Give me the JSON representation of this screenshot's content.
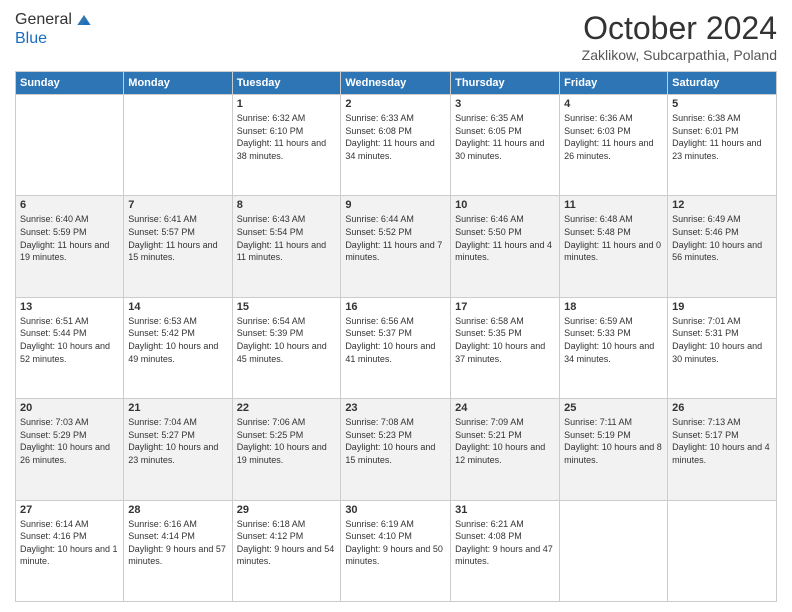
{
  "header": {
    "logo_line1": "General",
    "logo_line2": "Blue",
    "month": "October 2024",
    "location": "Zaklikow, Subcarpathia, Poland"
  },
  "days_of_week": [
    "Sunday",
    "Monday",
    "Tuesday",
    "Wednesday",
    "Thursday",
    "Friday",
    "Saturday"
  ],
  "weeks": [
    [
      {
        "day": "",
        "content": ""
      },
      {
        "day": "",
        "content": ""
      },
      {
        "day": "1",
        "content": "Sunrise: 6:32 AM\nSunset: 6:10 PM\nDaylight: 11 hours and 38 minutes."
      },
      {
        "day": "2",
        "content": "Sunrise: 6:33 AM\nSunset: 6:08 PM\nDaylight: 11 hours and 34 minutes."
      },
      {
        "day": "3",
        "content": "Sunrise: 6:35 AM\nSunset: 6:05 PM\nDaylight: 11 hours and 30 minutes."
      },
      {
        "day": "4",
        "content": "Sunrise: 6:36 AM\nSunset: 6:03 PM\nDaylight: 11 hours and 26 minutes."
      },
      {
        "day": "5",
        "content": "Sunrise: 6:38 AM\nSunset: 6:01 PM\nDaylight: 11 hours and 23 minutes."
      }
    ],
    [
      {
        "day": "6",
        "content": "Sunrise: 6:40 AM\nSunset: 5:59 PM\nDaylight: 11 hours and 19 minutes."
      },
      {
        "day": "7",
        "content": "Sunrise: 6:41 AM\nSunset: 5:57 PM\nDaylight: 11 hours and 15 minutes."
      },
      {
        "day": "8",
        "content": "Sunrise: 6:43 AM\nSunset: 5:54 PM\nDaylight: 11 hours and 11 minutes."
      },
      {
        "day": "9",
        "content": "Sunrise: 6:44 AM\nSunset: 5:52 PM\nDaylight: 11 hours and 7 minutes."
      },
      {
        "day": "10",
        "content": "Sunrise: 6:46 AM\nSunset: 5:50 PM\nDaylight: 11 hours and 4 minutes."
      },
      {
        "day": "11",
        "content": "Sunrise: 6:48 AM\nSunset: 5:48 PM\nDaylight: 11 hours and 0 minutes."
      },
      {
        "day": "12",
        "content": "Sunrise: 6:49 AM\nSunset: 5:46 PM\nDaylight: 10 hours and 56 minutes."
      }
    ],
    [
      {
        "day": "13",
        "content": "Sunrise: 6:51 AM\nSunset: 5:44 PM\nDaylight: 10 hours and 52 minutes."
      },
      {
        "day": "14",
        "content": "Sunrise: 6:53 AM\nSunset: 5:42 PM\nDaylight: 10 hours and 49 minutes."
      },
      {
        "day": "15",
        "content": "Sunrise: 6:54 AM\nSunset: 5:39 PM\nDaylight: 10 hours and 45 minutes."
      },
      {
        "day": "16",
        "content": "Sunrise: 6:56 AM\nSunset: 5:37 PM\nDaylight: 10 hours and 41 minutes."
      },
      {
        "day": "17",
        "content": "Sunrise: 6:58 AM\nSunset: 5:35 PM\nDaylight: 10 hours and 37 minutes."
      },
      {
        "day": "18",
        "content": "Sunrise: 6:59 AM\nSunset: 5:33 PM\nDaylight: 10 hours and 34 minutes."
      },
      {
        "day": "19",
        "content": "Sunrise: 7:01 AM\nSunset: 5:31 PM\nDaylight: 10 hours and 30 minutes."
      }
    ],
    [
      {
        "day": "20",
        "content": "Sunrise: 7:03 AM\nSunset: 5:29 PM\nDaylight: 10 hours and 26 minutes."
      },
      {
        "day": "21",
        "content": "Sunrise: 7:04 AM\nSunset: 5:27 PM\nDaylight: 10 hours and 23 minutes."
      },
      {
        "day": "22",
        "content": "Sunrise: 7:06 AM\nSunset: 5:25 PM\nDaylight: 10 hours and 19 minutes."
      },
      {
        "day": "23",
        "content": "Sunrise: 7:08 AM\nSunset: 5:23 PM\nDaylight: 10 hours and 15 minutes."
      },
      {
        "day": "24",
        "content": "Sunrise: 7:09 AM\nSunset: 5:21 PM\nDaylight: 10 hours and 12 minutes."
      },
      {
        "day": "25",
        "content": "Sunrise: 7:11 AM\nSunset: 5:19 PM\nDaylight: 10 hours and 8 minutes."
      },
      {
        "day": "26",
        "content": "Sunrise: 7:13 AM\nSunset: 5:17 PM\nDaylight: 10 hours and 4 minutes."
      }
    ],
    [
      {
        "day": "27",
        "content": "Sunrise: 6:14 AM\nSunset: 4:16 PM\nDaylight: 10 hours and 1 minute."
      },
      {
        "day": "28",
        "content": "Sunrise: 6:16 AM\nSunset: 4:14 PM\nDaylight: 9 hours and 57 minutes."
      },
      {
        "day": "29",
        "content": "Sunrise: 6:18 AM\nSunset: 4:12 PM\nDaylight: 9 hours and 54 minutes."
      },
      {
        "day": "30",
        "content": "Sunrise: 6:19 AM\nSunset: 4:10 PM\nDaylight: 9 hours and 50 minutes."
      },
      {
        "day": "31",
        "content": "Sunrise: 6:21 AM\nSunset: 4:08 PM\nDaylight: 9 hours and 47 minutes."
      },
      {
        "day": "",
        "content": ""
      },
      {
        "day": "",
        "content": ""
      }
    ]
  ]
}
